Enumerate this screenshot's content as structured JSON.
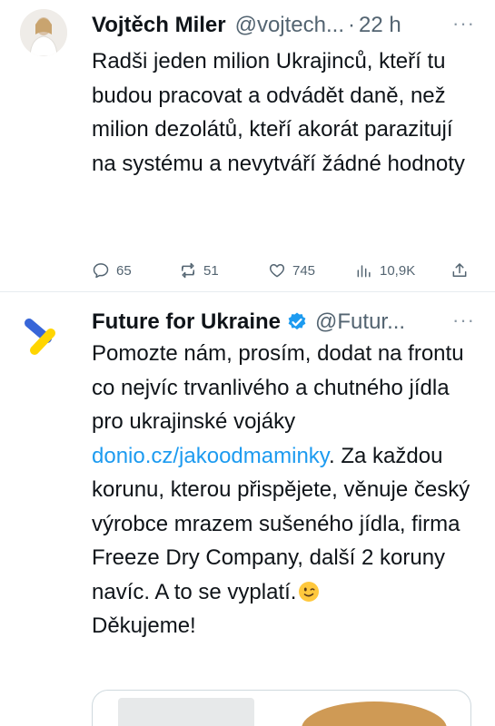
{
  "tweets": [
    {
      "author": {
        "name": "Vojtěch Miler",
        "handle": "@vojtech...",
        "dot": "·",
        "time": "22 h",
        "avatar_icon": "person-photo-avatar"
      },
      "more_label": "···",
      "text": "Radši jeden milion Ukrajinců, kteří tu budou pracovat a odvádět daně, než milion dezolátů, kteří akorát parazitují na systému a nevytváří žádné hodnoty",
      "stats": {
        "replies": "65",
        "retweets": "51",
        "likes": "745",
        "views": "10,9K"
      }
    },
    {
      "author": {
        "name": "Future for Ukraine",
        "verified_icon": "verified-badge-icon",
        "handle": "@Futur...",
        "avatar_icon": "ukraine-blue-yellow-logo"
      },
      "more_label": "···",
      "text_part1": "Pomozte nám, prosím, dodat na frontu co nejvíc trvanlivého a chutného jídla pro ukrajinské vojáky",
      "link": "donio.cz/jakoodmaminky",
      "text_part2": ". Za každou korunu, kterou přispějete, věnuje český výrobce mrazem sušeného jídla, firma Freeze Dry Company, další 2 koruny navíc. A to se vyplatí.",
      "emoji_icon": "winking-face-emoji",
      "text_part3": "Děkujeme!",
      "media_icon": "product-photo-preview"
    }
  ],
  "colors": {
    "text": "#0f1419",
    "secondary": "#536471",
    "link": "#1d9bf0",
    "verified": "#1d9bf0",
    "logo_blue": "#3866d8",
    "logo_yellow": "#ffd500",
    "divider": "#e6ecf0"
  }
}
